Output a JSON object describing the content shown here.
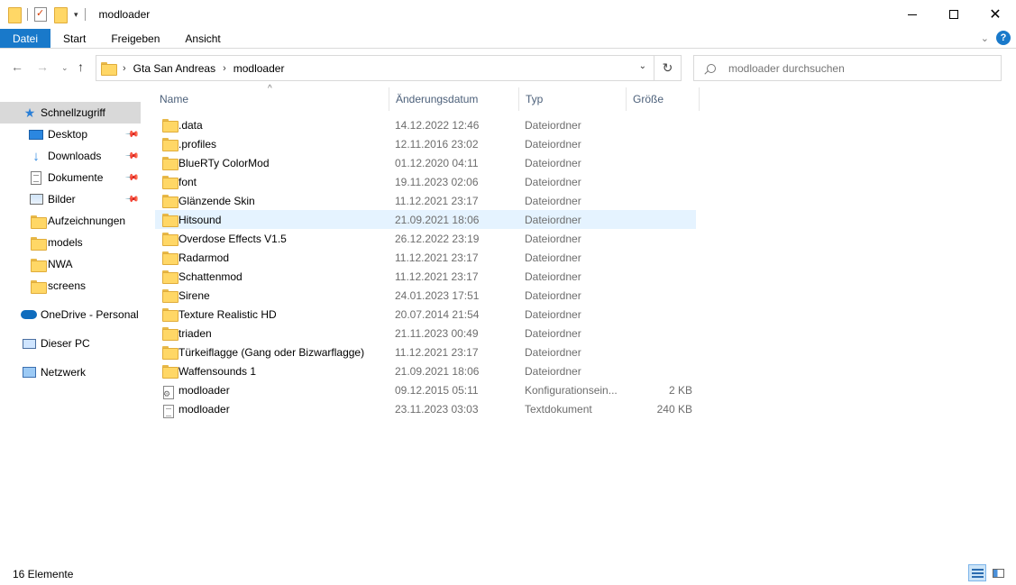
{
  "window": {
    "title": "modloader"
  },
  "ribbon": {
    "tabs": [
      "Datei",
      "Start",
      "Freigeben",
      "Ansicht"
    ]
  },
  "address": {
    "crumbs": [
      "Gta San Andreas",
      "modloader"
    ]
  },
  "search": {
    "placeholder": "modloader durchsuchen"
  },
  "sidebar": {
    "items": [
      {
        "label": "Schnellzugriff",
        "icon": "star-icon"
      },
      {
        "label": "Desktop",
        "icon": "desktop-icon",
        "pinned": true
      },
      {
        "label": "Downloads",
        "icon": "download-icon",
        "pinned": true
      },
      {
        "label": "Dokumente",
        "icon": "documents-icon",
        "pinned": true
      },
      {
        "label": "Bilder",
        "icon": "pictures-icon",
        "pinned": true
      },
      {
        "label": "Aufzeichnungen",
        "icon": "folder-icon"
      },
      {
        "label": "models",
        "icon": "folder-icon"
      },
      {
        "label": "NWA",
        "icon": "folder-icon"
      },
      {
        "label": "screens",
        "icon": "folder-icon"
      },
      {
        "label": "OneDrive - Personal",
        "icon": "onedrive-icon"
      },
      {
        "label": "Dieser PC",
        "icon": "pc-icon"
      },
      {
        "label": "Netzwerk",
        "icon": "network-icon"
      }
    ]
  },
  "columns": {
    "name": "Name",
    "date": "Änderungsdatum",
    "type": "Typ",
    "size": "Größe"
  },
  "files": [
    {
      "name": ".data",
      "date": "14.12.2022 12:46",
      "type": "Dateiordner",
      "size": "",
      "icon": "folder-icon"
    },
    {
      "name": ".profiles",
      "date": "12.11.2016 23:02",
      "type": "Dateiordner",
      "size": "",
      "icon": "folder-icon"
    },
    {
      "name": "BlueRTy ColorMod",
      "date": "01.12.2020 04:11",
      "type": "Dateiordner",
      "size": "",
      "icon": "folder-icon"
    },
    {
      "name": "font",
      "date": "19.11.2023 02:06",
      "type": "Dateiordner",
      "size": "",
      "icon": "folder-icon"
    },
    {
      "name": "Glänzende Skin",
      "date": "11.12.2021 23:17",
      "type": "Dateiordner",
      "size": "",
      "icon": "folder-icon"
    },
    {
      "name": "Hitsound",
      "date": "21.09.2021 18:06",
      "type": "Dateiordner",
      "size": "",
      "icon": "folder-icon"
    },
    {
      "name": "Overdose Effects V1.5",
      "date": "26.12.2022 23:19",
      "type": "Dateiordner",
      "size": "",
      "icon": "folder-icon"
    },
    {
      "name": "Radarmod",
      "date": "11.12.2021 23:17",
      "type": "Dateiordner",
      "size": "",
      "icon": "folder-icon"
    },
    {
      "name": "Schattenmod",
      "date": "11.12.2021 23:17",
      "type": "Dateiordner",
      "size": "",
      "icon": "folder-icon"
    },
    {
      "name": "Sirene",
      "date": "24.01.2023 17:51",
      "type": "Dateiordner",
      "size": "",
      "icon": "folder-icon"
    },
    {
      "name": "Texture Realistic HD",
      "date": "20.07.2014 21:54",
      "type": "Dateiordner",
      "size": "",
      "icon": "folder-icon"
    },
    {
      "name": "triaden",
      "date": "21.11.2023 00:49",
      "type": "Dateiordner",
      "size": "",
      "icon": "folder-icon"
    },
    {
      "name": "Türkeiflagge (Gang oder Bizwarflagge)",
      "date": "11.12.2021 23:17",
      "type": "Dateiordner",
      "size": "",
      "icon": "folder-icon"
    },
    {
      "name": "Waffensounds 1",
      "date": "21.09.2021 18:06",
      "type": "Dateiordner",
      "size": "",
      "icon": "folder-icon"
    },
    {
      "name": "modloader",
      "date": "09.12.2015 05:11",
      "type": "Konfigurationsein...",
      "size": "2 KB",
      "icon": "config-file-icon"
    },
    {
      "name": "modloader",
      "date": "23.11.2023 03:03",
      "type": "Textdokument",
      "size": "240 KB",
      "icon": "text-file-icon"
    }
  ],
  "status": {
    "count": "16 Elemente"
  }
}
